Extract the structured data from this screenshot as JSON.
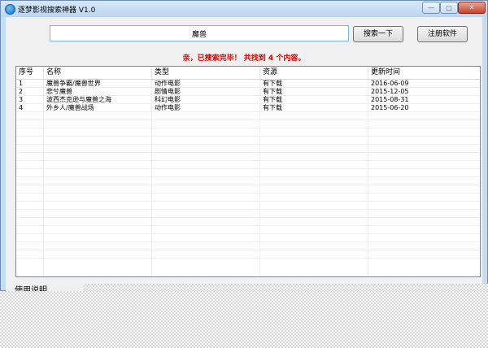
{
  "window": {
    "title": "逐梦影视搜索神器 V1.0",
    "minimize": "—",
    "maximize": "□",
    "close": "✕"
  },
  "search": {
    "value": "魔兽",
    "search_button": "搜索一下",
    "register_button": "注册软件"
  },
  "status": "亲，已搜索完毕！ 共找到 4 个内容。",
  "table": {
    "columns": [
      "序号",
      "名称",
      "类型",
      "资源",
      "更新时间"
    ],
    "rows": [
      [
        "1",
        "魔兽争霸/魔兽世界",
        "动作电影",
        "有下载",
        "2016-06-09"
      ],
      [
        "2",
        "悲兮魔兽",
        "剧情电影",
        "有下载",
        "2015-12-05"
      ],
      [
        "3",
        "波西杰克逊与魔兽之海",
        "科幻电影",
        "有下载",
        "2015-08-31"
      ],
      [
        "4",
        "外乡人/魔兽战场",
        "动作电影",
        "有下载",
        "2015-06-20"
      ]
    ]
  },
  "usage_label": "使用说明"
}
